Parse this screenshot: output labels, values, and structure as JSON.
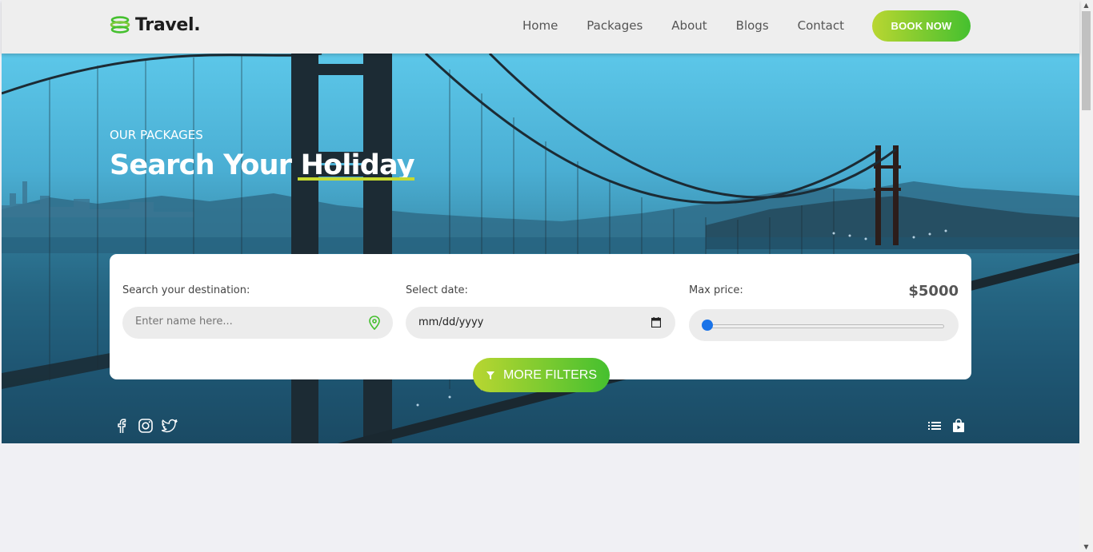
{
  "brand": {
    "name": "Travel."
  },
  "nav": {
    "items": [
      "Home",
      "Packages",
      "About",
      "Blogs",
      "Contact"
    ],
    "cta": "BOOK NOW"
  },
  "hero": {
    "eyebrow": "OUR PACKAGES",
    "title_prefix": "Search Your",
    "title_highlight": "Holiday"
  },
  "search": {
    "destination_label": "Search your destination:",
    "destination_placeholder": "Enter name here...",
    "date_label": "Select date:",
    "date_placeholder": "mm/dd/yyyy",
    "price_label": "Max price:",
    "price_value": "$5000",
    "filters_button": "MORE FILTERS"
  },
  "colors": {
    "accent_start": "#b9d631",
    "accent_end": "#45c02f",
    "highlight_underline": "#c6d92f",
    "slider": "#1a73e8"
  },
  "icons": {
    "social": [
      "facebook-icon",
      "instagram-icon",
      "twitter-icon"
    ],
    "utility": [
      "list-icon",
      "shopping-bag-icon"
    ]
  }
}
